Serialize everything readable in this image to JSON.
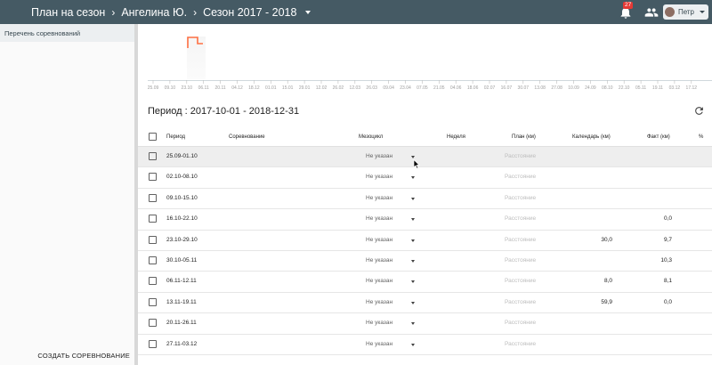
{
  "topbar": {
    "breadcrumb": [
      "План на сезон",
      "Ангелина Ю.",
      "Сезон 2017 - 2018"
    ],
    "notifications_count": "27",
    "user_name": "Петр"
  },
  "sidebar": {
    "header": "Перечень соревнований",
    "create_button": "СОЗДАТЬ СОРЕВНОВАНИЕ"
  },
  "timeline": {
    "labels": [
      "25.09",
      "09.10",
      "23.10",
      "06.11",
      "20.11",
      "04.12",
      "18.12",
      "01.01",
      "15.01",
      "29.01",
      "12.02",
      "26.02",
      "12.03",
      "26.03",
      "09.04",
      "23.04",
      "07.05",
      "21.05",
      "04.06",
      "18.06",
      "02.07",
      "16.07",
      "30.07",
      "13.08",
      "27.08",
      "10.09",
      "24.09",
      "08.10",
      "22.10",
      "05.11",
      "19.11",
      "03.12",
      "17.12"
    ]
  },
  "period": {
    "title": "Период : 2017-10-01 - 2018-12-31"
  },
  "table": {
    "headers": {
      "period": "Период",
      "competition": "Соревнование",
      "mesocycle": "Мезоцикл",
      "week": "Неделя",
      "plan": "План (км)",
      "calendar": "Календарь (км)",
      "fact": "Факт (км)",
      "percent": "%"
    },
    "rows": [
      {
        "period": "25.09-01.10",
        "meso": "Не указан",
        "plan": "Расстояние",
        "calendar": "",
        "fact": ""
      },
      {
        "period": "02.10-08.10",
        "meso": "Не указан",
        "plan": "Расстояние",
        "calendar": "",
        "fact": ""
      },
      {
        "period": "09.10-15.10",
        "meso": "Не указан",
        "plan": "Расстояние",
        "calendar": "",
        "fact": ""
      },
      {
        "period": "16.10-22.10",
        "meso": "Не указан",
        "plan": "Расстояние",
        "calendar": "",
        "fact": "0,0"
      },
      {
        "period": "23.10-29.10",
        "meso": "Не указан",
        "plan": "Расстояние",
        "calendar": "30,0",
        "fact": "9,7"
      },
      {
        "period": "30.10-05.11",
        "meso": "Не указан",
        "plan": "Расстояние",
        "calendar": "",
        "fact": "10,3"
      },
      {
        "period": "06.11-12.11",
        "meso": "Не указан",
        "plan": "Расстояние",
        "calendar": "8,0",
        "fact": "8,1"
      },
      {
        "period": "13.11-19.11",
        "meso": "Не указан",
        "plan": "Расстояние",
        "calendar": "59,9",
        "fact": "0,0"
      },
      {
        "period": "20.11-26.11",
        "meso": "Не указан",
        "plan": "Расстояние",
        "calendar": "",
        "fact": ""
      },
      {
        "period": "27.11-03.12",
        "meso": "Не указан",
        "plan": "Расстояние",
        "calendar": "",
        "fact": ""
      }
    ]
  },
  "colors": {
    "topbar": "#455a64",
    "accent_orange": "#ff7043"
  }
}
